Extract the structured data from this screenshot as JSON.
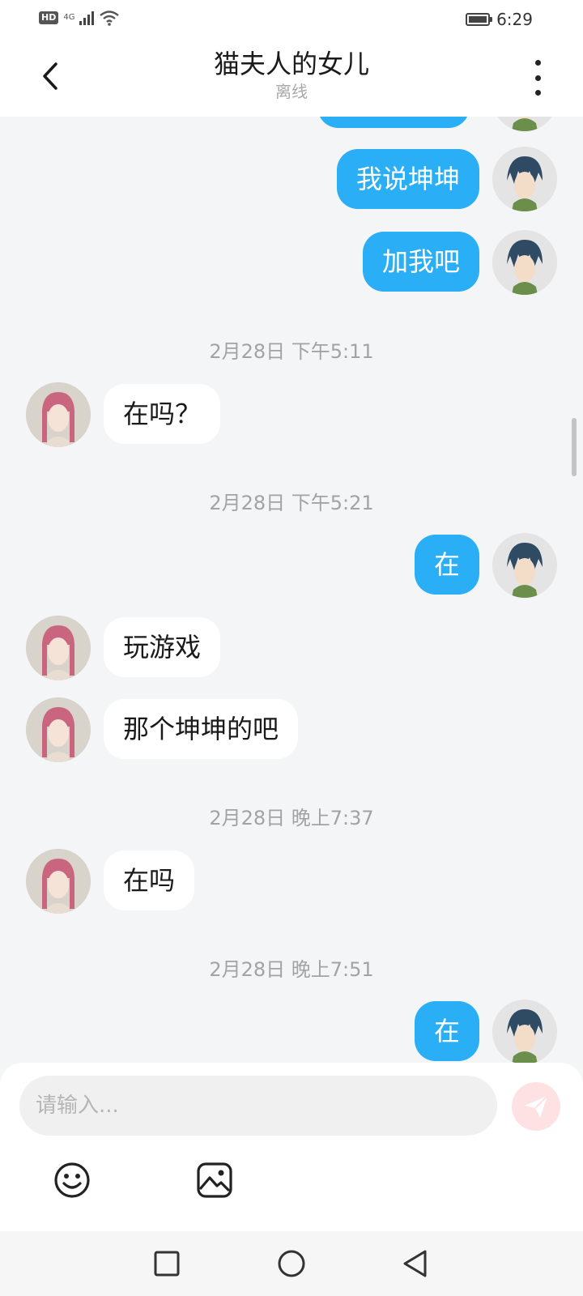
{
  "status_bar": {
    "hd": "HD",
    "network": "4G",
    "time": "6:29"
  },
  "header": {
    "title": "猫夫人的女儿",
    "status": "离线"
  },
  "messages": {
    "self_1_partial": "",
    "self_2": "我说坤坤",
    "self_3": "加我吧",
    "ts_1": "2月28日 下午5:11",
    "peer_1": "在吗？",
    "ts_2": "2月28日 下午5:21",
    "self_4": "在",
    "peer_2": "玩游戏",
    "peer_3": "那个坤坤的吧",
    "ts_3": "2月28日 晚上7:37",
    "peer_4": "在吗",
    "ts_4": "2月28日 晚上7:51",
    "self_5": "在"
  },
  "composer": {
    "placeholder": "请输入..."
  },
  "icons": {
    "back": "chevron-left-icon",
    "more": "more-vertical-icon",
    "send": "send-icon",
    "emoji": "emoji-icon",
    "image": "image-icon",
    "nav_recents": "square-icon",
    "nav_home": "circle-icon",
    "nav_back": "triangle-back-icon"
  },
  "colors": {
    "self_bubble": "#2aaef5",
    "peer_bubble": "#ffffff",
    "background": "#f4f5f7",
    "send_button": "#fde1e3"
  }
}
